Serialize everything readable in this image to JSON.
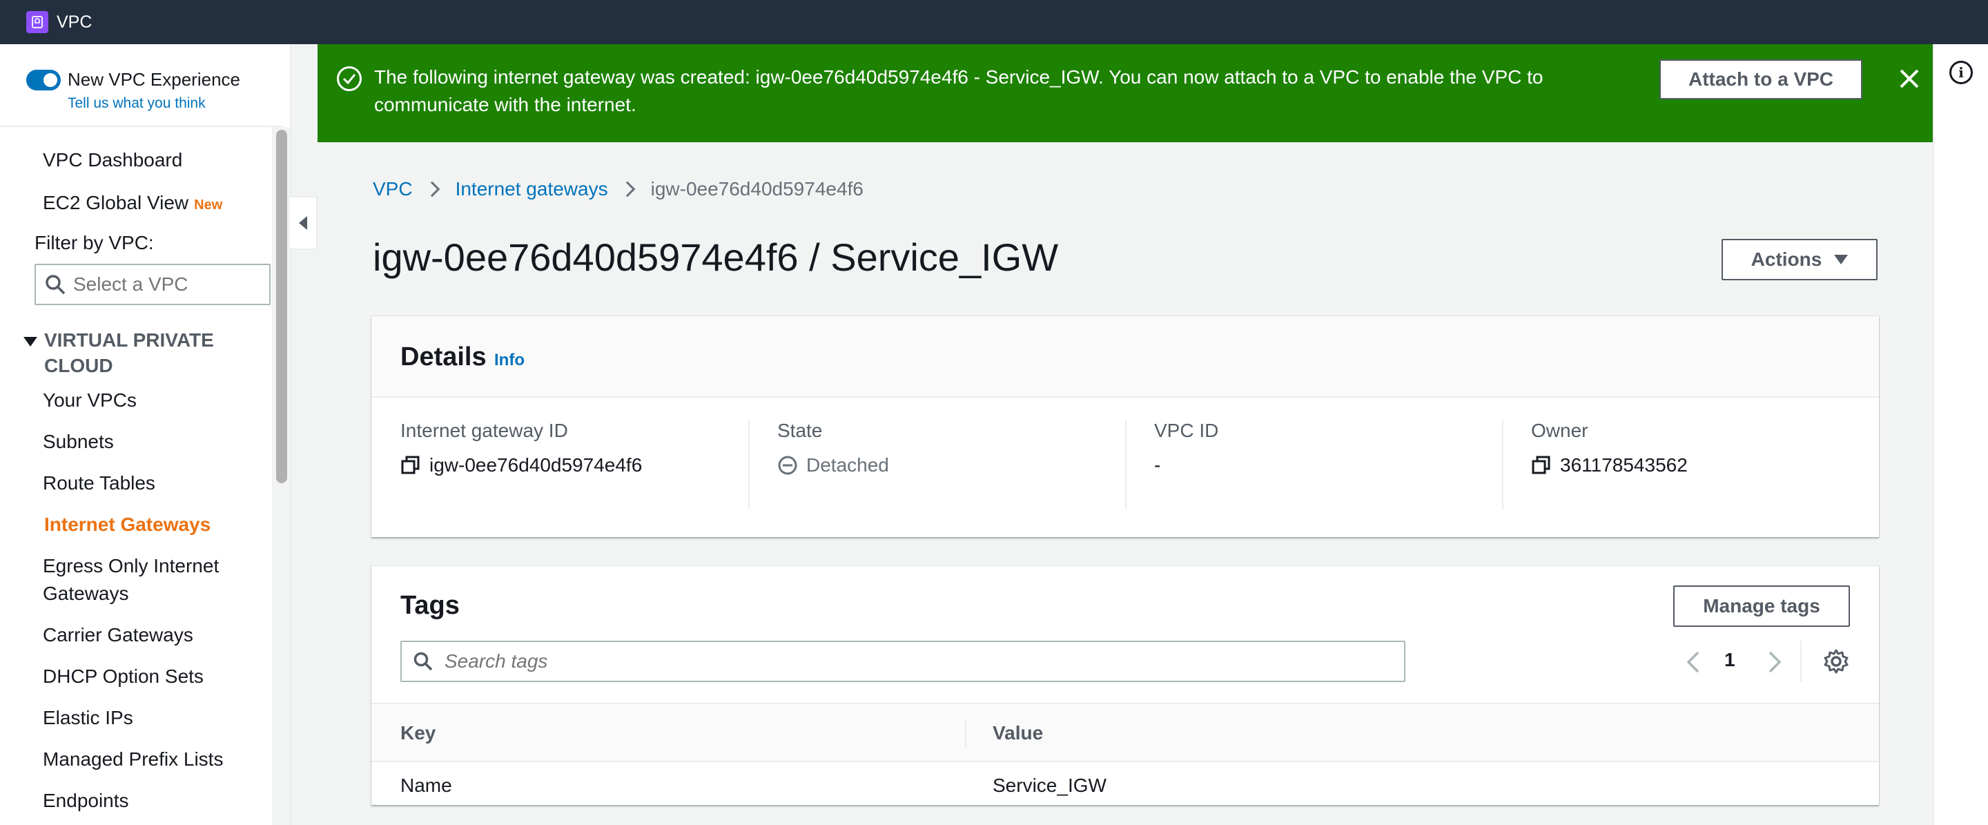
{
  "topbar": {
    "service_name": "VPC"
  },
  "sidebar": {
    "toggle_label": "New VPC Experience",
    "feedback_link": "Tell us what you think",
    "dashboard": "VPC Dashboard",
    "global_view": "EC2 Global View",
    "new_badge": "New",
    "filter_label": "Filter by VPC:",
    "filter_placeholder": "Select a VPC",
    "section_title": "VIRTUAL PRIVATE CLOUD",
    "items": [
      "Your VPCs",
      "Subnets",
      "Route Tables",
      "Internet Gateways",
      "Egress Only Internet Gateways",
      "Carrier Gateways",
      "DHCP Option Sets",
      "Elastic IPs",
      "Managed Prefix Lists",
      "Endpoints"
    ],
    "active_item": "Internet Gateways"
  },
  "flash": {
    "message": "The following internet gateway was created: igw-0ee76d40d5974e4f6 - Service_IGW. You can now attach to a VPC to enable the VPC to communicate with the internet.",
    "action_label": "Attach to a VPC"
  },
  "breadcrumb": {
    "items": [
      "VPC",
      "Internet gateways"
    ],
    "current": "igw-0ee76d40d5974e4f6"
  },
  "page": {
    "title": "igw-0ee76d40d5974e4f6 / Service_IGW",
    "actions_label": "Actions"
  },
  "details": {
    "title": "Details",
    "info_link": "Info",
    "fields": [
      {
        "label": "Internet gateway ID",
        "value": "igw-0ee76d40d5974e4f6"
      },
      {
        "label": "State",
        "value": "Detached"
      },
      {
        "label": "VPC ID",
        "value": "-"
      },
      {
        "label": "Owner",
        "value": "361178543562"
      }
    ]
  },
  "tags": {
    "title": "Tags",
    "manage_label": "Manage tags",
    "search_placeholder": "Search tags",
    "page_number": "1",
    "columns": [
      "Key",
      "Value"
    ],
    "rows": [
      {
        "key": "Name",
        "value": "Service_IGW"
      }
    ]
  },
  "colors": {
    "success_banner": "#1d8102",
    "link": "#0073bb",
    "active_nav": "#ec7211",
    "header_bg": "#232f3e"
  }
}
